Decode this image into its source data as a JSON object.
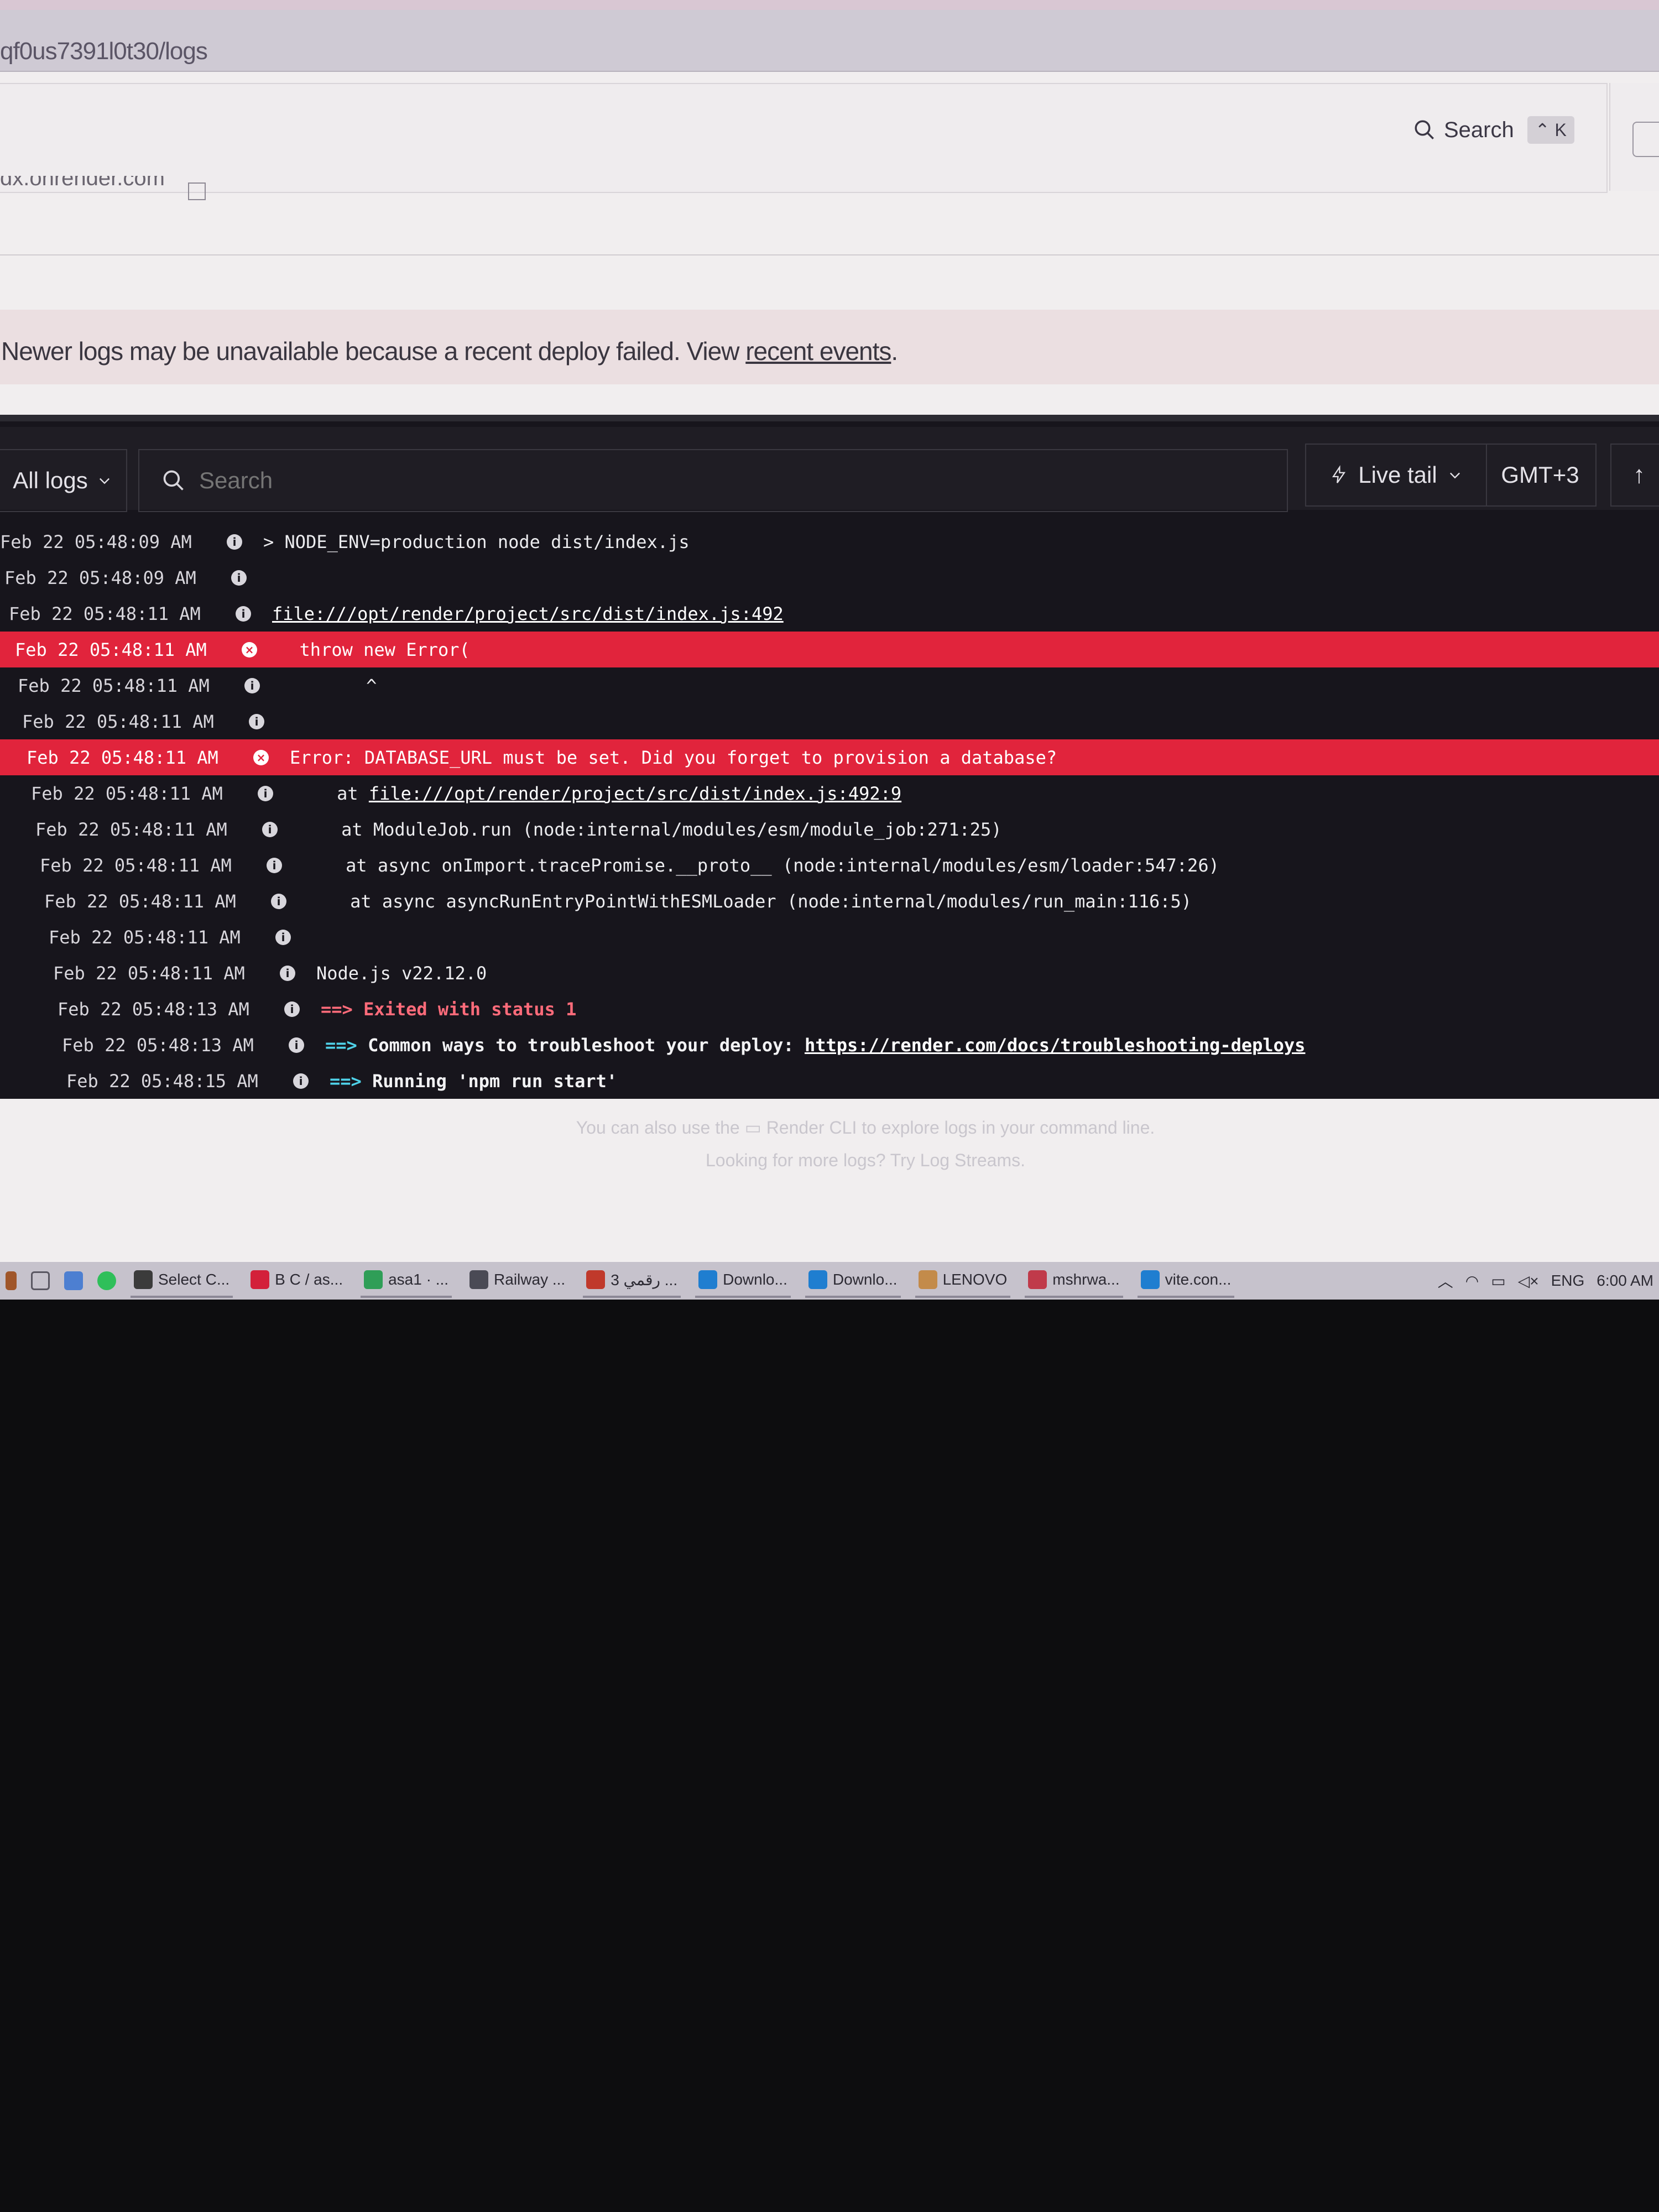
{
  "browser": {
    "url": "qf0us7391l0t30/logs"
  },
  "header": {
    "search_label": "Search",
    "search_shortcut": "⌃ K",
    "domain": "dx.onrender.com"
  },
  "banner": {
    "text": "Newer logs may be unavailable because a recent deploy failed. View ",
    "link": "recent events",
    "suffix": "."
  },
  "toolbar": {
    "all_logs": "All logs",
    "search_placeholder": "Search",
    "live_tail": "Live tail",
    "timezone": "GMT+3",
    "up_icon": "arrow-up-icon"
  },
  "logs": [
    {
      "ts": "Feb 22 05:48:09 AM",
      "level": "info",
      "msg": "> NODE_ENV=production node dist/index.js"
    },
    {
      "ts": "Feb 22 05:48:09 AM",
      "level": "info",
      "msg": ""
    },
    {
      "ts": "Feb 22 05:48:11 AM",
      "level": "info",
      "link": "file:///opt/render/project/src/dist/index.js:492"
    },
    {
      "ts": "Feb 22 05:48:11 AM",
      "level": "error",
      "msg": "  throw new Error("
    },
    {
      "ts": "Feb 22 05:48:11 AM",
      "level": "info",
      "msg": "        ^"
    },
    {
      "ts": "Feb 22 05:48:11 AM",
      "level": "info",
      "msg": ""
    },
    {
      "ts": "Feb 22 05:48:11 AM",
      "level": "error",
      "msg": "Error: DATABASE_URL must be set. Did you forget to provision a database?"
    },
    {
      "ts": "Feb 22 05:48:11 AM",
      "level": "info",
      "msg": "    at ",
      "link": "file:///opt/render/project/src/dist/index.js:492:9"
    },
    {
      "ts": "Feb 22 05:48:11 AM",
      "level": "info",
      "msg": "    at ModuleJob.run (node:internal/modules/esm/module_job:271:25)"
    },
    {
      "ts": "Feb 22 05:48:11 AM",
      "level": "info",
      "msg": "    at async onImport.tracePromise.__proto__ (node:internal/modules/esm/loader:547:26)"
    },
    {
      "ts": "Feb 22 05:48:11 AM",
      "level": "info",
      "msg": "    at async asyncRunEntryPointWithESMLoader (node:internal/modules/run_main:116:5)"
    },
    {
      "ts": "Feb 22 05:48:11 AM",
      "level": "info",
      "msg": ""
    },
    {
      "ts": "Feb 22 05:48:11 AM",
      "level": "info",
      "msg": "Node.js v22.12.0"
    },
    {
      "ts": "Feb 22 05:48:13 AM",
      "level": "info",
      "arrow": "==>",
      "arrow_color": "red",
      "msg": " Exited with status 1"
    },
    {
      "ts": "Feb 22 05:48:13 AM",
      "level": "info",
      "arrow": "==>",
      "arrow_color": "cyan",
      "msg": " Common ways to troubleshoot your deploy: ",
      "link": "https://render.com/docs/troubleshooting-deploys"
    },
    {
      "ts": "Feb 22 05:48:15 AM",
      "level": "info",
      "arrow": "==>",
      "arrow_color": "cyan",
      "msg": " Running 'npm run start'"
    }
  ],
  "footer": {
    "cli_note_pre": "You can also use the ",
    "cli_note_link": "Render CLI",
    "cli_note_post": " to explore logs in your command line.",
    "streams_note": "Looking for more logs? Try Log Streams."
  },
  "taskbar": {
    "items": [
      {
        "label": "Select C...",
        "icon": "terminal-icon",
        "color": "#3b3b3b"
      },
      {
        "label": "B C / as...",
        "icon": "opera-icon",
        "color": "#d3203a"
      },
      {
        "label": "asa1 · ...",
        "icon": "chrome-icon",
        "color": "#2f9e57"
      },
      {
        "label": "Railway ...",
        "icon": "railway-icon",
        "color": "#4a4a55"
      },
      {
        "label": "رقمي 3 ...",
        "icon": "chrome-icon",
        "color": "#c0392b"
      },
      {
        "label": "Downlo...",
        "icon": "download-icon",
        "color": "#1f7ed0"
      },
      {
        "label": "Downlo...",
        "icon": "download-icon",
        "color": "#1f7ed0"
      },
      {
        "label": "LENOVO",
        "icon": "user-icon",
        "color": "#c38b4a"
      },
      {
        "label": "mshrwa...",
        "icon": "app-icon",
        "color": "#c03a4a"
      },
      {
        "label": "vite.con...",
        "icon": "vscode-icon",
        "color": "#1f7ed0"
      }
    ],
    "tray": {
      "lang": "ENG",
      "time": "6:00 AM"
    }
  }
}
